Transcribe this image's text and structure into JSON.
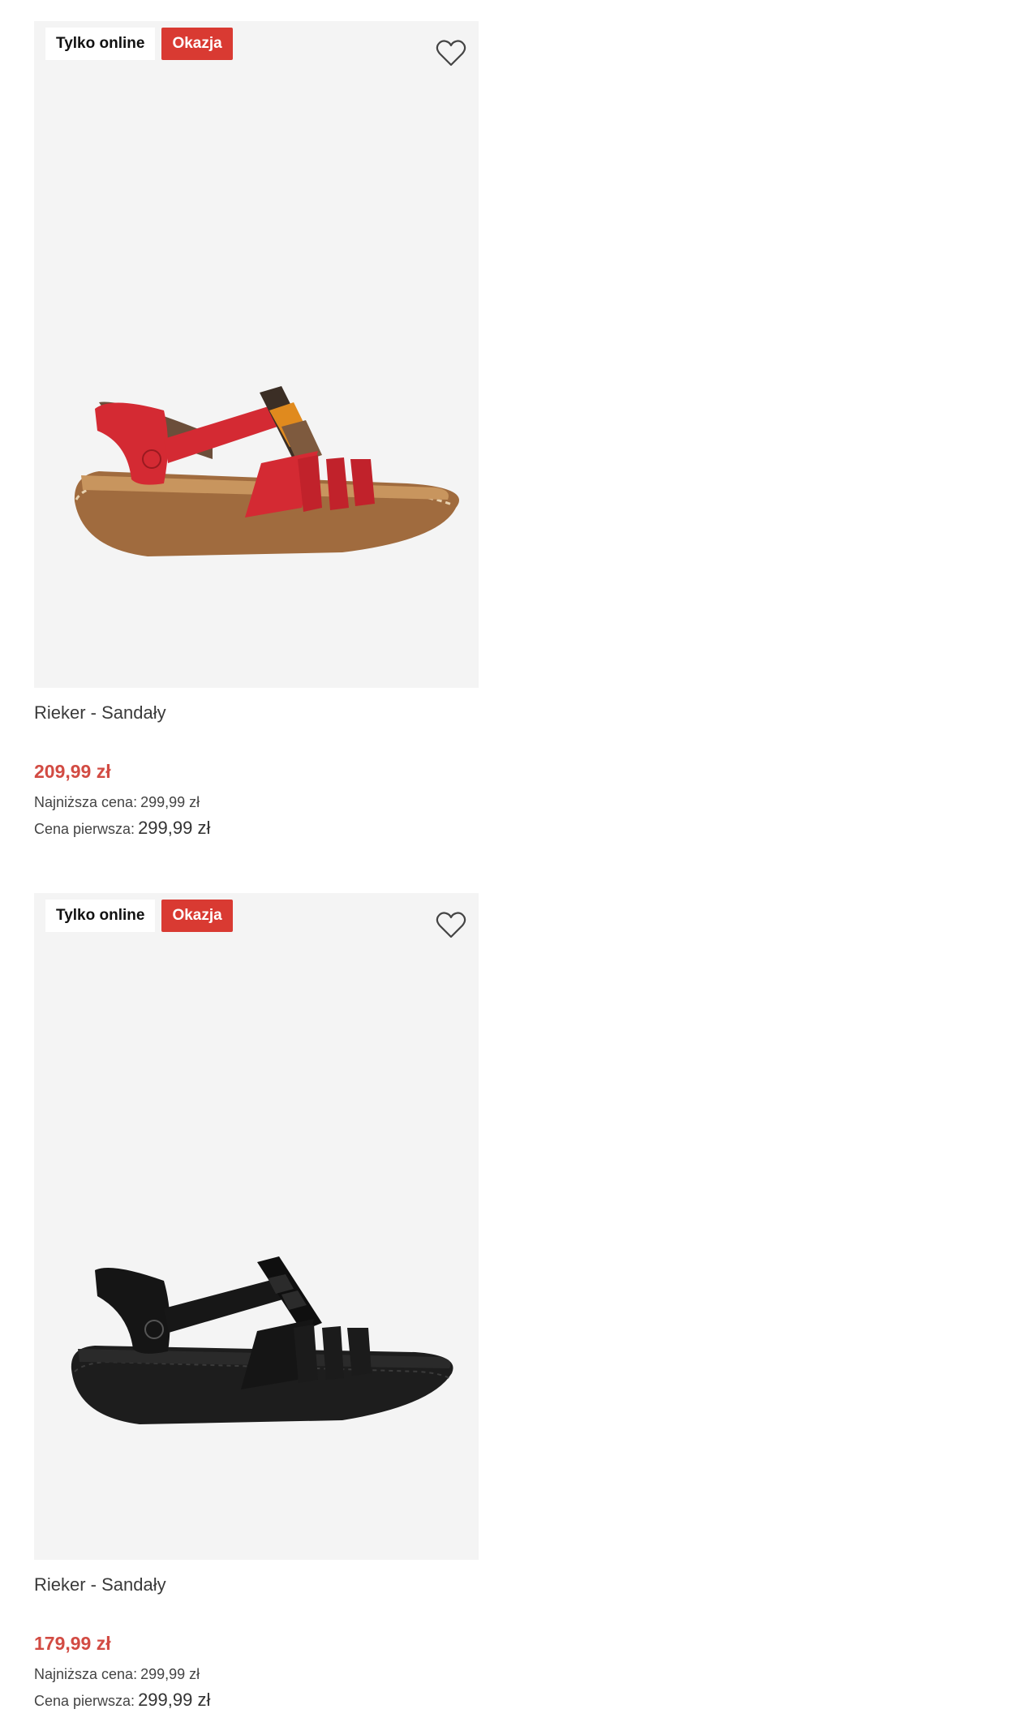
{
  "products": [
    {
      "badge_online": "Tylko online",
      "badge_deal": "Okazja",
      "wishlist_icon": "heart-outline-icon",
      "image_label": "red sandal",
      "title": "Rieker - Sandały",
      "price": "209,99 zł",
      "lowest_label": "Najniższa cena:",
      "lowest_value": "299,99 zł",
      "first_label": "Cena pierwsza:",
      "first_value": "299,99 zł"
    },
    {
      "badge_online": "Tylko online",
      "badge_deal": "Okazja",
      "wishlist_icon": "heart-outline-icon",
      "image_label": "black sandal",
      "title": "Rieker - Sandały",
      "price": "179,99 zł",
      "lowest_label": "Najniższa cena:",
      "lowest_value": "299,99 zł",
      "first_label": "Cena pierwsza:",
      "first_value": "299,99 zł"
    }
  ],
  "colors": {
    "accent_red": "#d93a32",
    "price_red": "#d24b43",
    "image_bg": "#f4f4f4"
  }
}
